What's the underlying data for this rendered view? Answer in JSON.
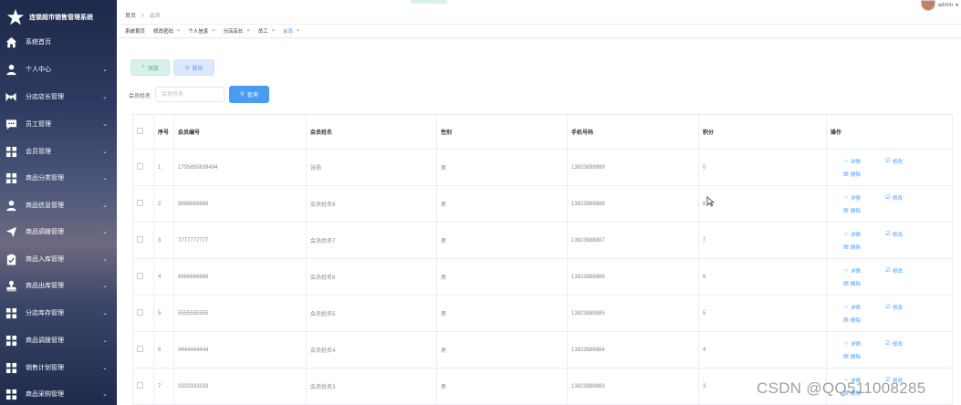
{
  "app": {
    "title": "连锁超市销售管理系统",
    "brand_color": "#1e2a4a"
  },
  "sidebar": {
    "items": [
      {
        "label": "系统首页",
        "icon": "home-icon",
        "has_children": false
      },
      {
        "label": "个人中心",
        "icon": "person-icon",
        "has_children": true
      },
      {
        "label": "分店店长管理",
        "icon": "bow-tie-icon",
        "has_children": true
      },
      {
        "label": "员工管理",
        "icon": "chat-icon",
        "has_children": true
      },
      {
        "label": "会员管理",
        "icon": "grid-icon",
        "has_children": true
      },
      {
        "label": "商品分类管理",
        "icon": "grid-icon",
        "has_children": true
      },
      {
        "label": "商品信息管理",
        "icon": "person-icon",
        "has_children": true
      },
      {
        "label": "商品调拨管理",
        "icon": "send-icon",
        "has_children": true
      },
      {
        "label": "商品入库管理",
        "icon": "clipboard-icon",
        "has_children": true
      },
      {
        "label": "商品出库管理",
        "icon": "stamp-icon",
        "has_children": true
      },
      {
        "label": "分店库存管理",
        "icon": "grid-icon",
        "has_children": true
      },
      {
        "label": "商品调拨管理",
        "icon": "grid-icon",
        "has_children": true
      },
      {
        "label": "销售计划管理",
        "icon": "grid-icon",
        "has_children": true
      },
      {
        "label": "商品采购管理",
        "icon": "grid-icon",
        "has_children": true
      }
    ]
  },
  "header": {
    "breadcrumb": [
      "首页",
      "会员"
    ],
    "user": "admin"
  },
  "tabs": [
    {
      "label": "系统首页",
      "closable": false,
      "active": false
    },
    {
      "label": "修改密码",
      "closable": true,
      "active": false
    },
    {
      "label": "个人信息",
      "closable": true,
      "active": false
    },
    {
      "label": "分店店长",
      "closable": true,
      "active": false
    },
    {
      "label": "员工",
      "closable": true,
      "active": false
    },
    {
      "label": "会员",
      "closable": true,
      "active": true
    }
  ],
  "toolbar": {
    "add_label": "添加",
    "delete_label": "删除",
    "search_label": "会员姓名",
    "search_placeholder": "会员姓名",
    "search_value": "",
    "query_label": "查询"
  },
  "table": {
    "columns": [
      "序号",
      "会员编号",
      "会员姓名",
      "性别",
      "手机号码",
      "积分",
      "操作"
    ],
    "rows": [
      {
        "idx": "1",
        "member_no": "1705850839494",
        "name": "张扬",
        "gender": "男",
        "phone": "13823899999",
        "points": "0"
      },
      {
        "idx": "2",
        "member_no": "8888888888",
        "name": "会员姓名8",
        "gender": "男",
        "phone": "13823888888",
        "points": "8"
      },
      {
        "idx": "3",
        "member_no": "7777777777",
        "name": "会员姓名7",
        "gender": "男",
        "phone": "13823888887",
        "points": "7"
      },
      {
        "idx": "4",
        "member_no": "6666666666",
        "name": "会员姓名6",
        "gender": "男",
        "phone": "13823888886",
        "points": "6"
      },
      {
        "idx": "5",
        "member_no": "5555555555",
        "name": "会员姓名5",
        "gender": "男",
        "phone": "13823888885",
        "points": "5"
      },
      {
        "idx": "6",
        "member_no": "4444444444",
        "name": "会员姓名4",
        "gender": "男",
        "phone": "13823888884",
        "points": "4"
      },
      {
        "idx": "7",
        "member_no": "3333333333",
        "name": "会员姓名3",
        "gender": "男",
        "phone": "13823888883",
        "points": "3"
      }
    ],
    "actions": {
      "detail": "详情",
      "edit": "修改",
      "delete": "删除"
    }
  },
  "watermark": "CSDN @QQ511008285"
}
